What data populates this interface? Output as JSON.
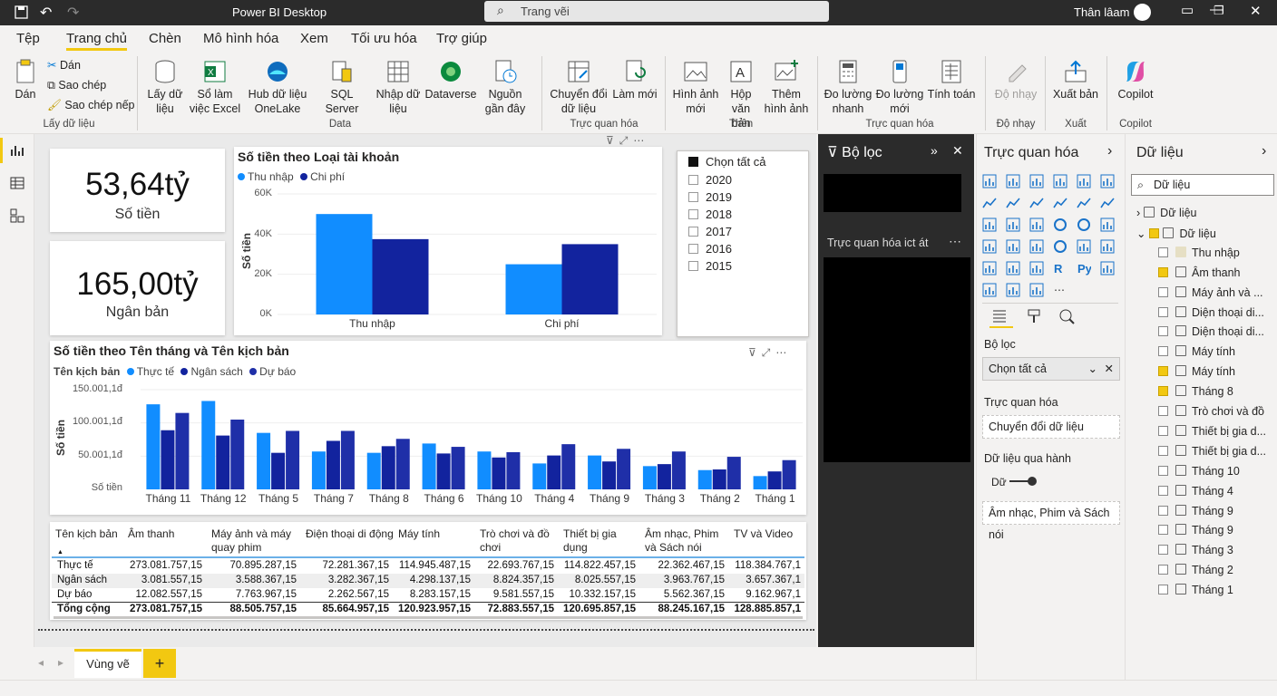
{
  "app": {
    "title": "Power BI Desktop",
    "search_placeholder": "Trang vẽi",
    "user": "Thân lâam"
  },
  "menu": [
    "Tệp",
    "Trang chủ",
    "Chèn",
    "Mô hình hóa",
    "Xem",
    "Tối ưu hóa",
    "Trợ giúp"
  ],
  "ribbon": {
    "paste": "Dán",
    "cut": "Dán",
    "copy": "Sao chép",
    "format_copy": "Sao chép nếp",
    "grp_clipboard": "Lấy dữ liệu",
    "get_data": "Lấy dữ liệu",
    "excel": "Sổ làm việc Excel",
    "onelake": "Hub dữ liệu OneLake",
    "sql": "SQL Server",
    "enter": "Nhập dữ liệu",
    "dataverse": "Dataverse",
    "recent": "Nguồn gần đây",
    "grp_data": "Data",
    "transform": "Chuyển đổi dữ liệu",
    "refresh": "Làm mới",
    "grp_query": "Trực quan hóa",
    "image": "Hình ảnh mới",
    "textbox": "Hộp văn bản",
    "more_visuals": "Thêm hình ảnh",
    "grp_insert": "Thên",
    "measure": "Đo lường nhanh",
    "new_measure": "Đo lường mới",
    "calc": "Tính toán",
    "grp_calc": "Trực quan hóa",
    "sensitivity": "Độ nhạy",
    "grp_sens": "Độ nhạy",
    "publish": "Xuất bản",
    "grp_share": "Xuất",
    "copilot": "Copilot",
    "grp_copilot": "Copilot"
  },
  "kpi": [
    {
      "value": "53,64tỷ",
      "label": "Số tiền"
    },
    {
      "value": "165,00tỷ",
      "label": "Ngân bản"
    }
  ],
  "chart1": {
    "title": "Số tiền theo Loại tài khoản",
    "legend": [
      "Thu nhập",
      "Chi phí"
    ],
    "ticks": [
      "60K",
      "40K",
      "20K",
      "0K"
    ],
    "ylabel": "Số tiền"
  },
  "chart2": {
    "title": "Số tiền theo Tên tháng và Tên kịch bản",
    "legend_title": "Tên kịch bản",
    "legend": [
      "Thực tế",
      "Ngân sách",
      "Dự báo"
    ],
    "ticks": [
      "150.001,1đ",
      "100.001,1đ",
      "50.001,1đ",
      "Số tiền"
    ],
    "ylabel": "Số tiền"
  },
  "chart_data": [
    {
      "type": "bar",
      "title": "Số tiền theo Loại tài khoản",
      "ylabel": "Số tiền",
      "categories": [
        "Thu nhập",
        "Chi phí"
      ],
      "series": [
        {
          "name": "Thu nhập",
          "values": [
            50000,
            25000
          ]
        },
        {
          "name": "Chi phí",
          "values": [
            37500,
            35000
          ]
        }
      ],
      "ylim": [
        0,
        60000
      ]
    },
    {
      "type": "bar",
      "title": "Số tiền theo Tên tháng và Tên kịch bản",
      "ylabel": "Số tiền",
      "categories": [
        "Tháng 11",
        "Tháng 12",
        "Tháng 5",
        "Tháng 7",
        "Tháng 8",
        "Tháng 6",
        "Tháng 10",
        "Tháng 4",
        "Tháng 9",
        "Tháng 3",
        "Tháng 2",
        "Tháng 1"
      ],
      "series": [
        {
          "name": "Thực tế",
          "values": [
            128000,
            133000,
            85000,
            57000,
            55000,
            69000,
            57000,
            39000,
            51000,
            35000,
            29000,
            20000
          ]
        },
        {
          "name": "Ngân sách",
          "values": [
            89000,
            81000,
            55000,
            73000,
            65000,
            54000,
            48000,
            51000,
            42000,
            38000,
            30000,
            27000
          ]
        },
        {
          "name": "Dự báo",
          "values": [
            115000,
            105000,
            88000,
            88000,
            76000,
            64000,
            56000,
            68000,
            61000,
            57000,
            49000,
            44000
          ]
        }
      ],
      "ylim": [
        0,
        150000
      ]
    }
  ],
  "slicer": {
    "all": "Chọn tất cả",
    "years": [
      "2020",
      "2019",
      "2018",
      "2017",
      "2016",
      "2015"
    ]
  },
  "table": {
    "headers": [
      "Tên kịch bản",
      "Âm thanh",
      "Máy ảnh và máy quay phim",
      "Điện thoại di động",
      "Máy tính",
      "Trò chơi và đồ chơi",
      "Thiết bị gia dụng",
      "Âm nhạc, Phim và Sách nói",
      "TV và Video"
    ],
    "rows": [
      [
        "Thực tế",
        "273.081.757,15",
        "70.895.287,15",
        "72.281.367,15",
        "114.945.487,15",
        "22.693.767,15",
        "114.822.457,15",
        "22.362.467,15",
        "118.384.767,1"
      ],
      [
        "Ngân sách",
        "3.081.557,15",
        "3.588.367,15",
        "3.282.367,15",
        "4.298.137,15",
        "8.824.357,15",
        "8.025.557,15",
        "3.963.767,15",
        "3.657.367,1"
      ],
      [
        "Dự báo",
        "12.082.557,15",
        "7.763.967,15",
        "2.262.567,15",
        "8.283.157,15",
        "9.581.557,15",
        "10.332.157,15",
        "5.562.367,15",
        "9.162.967,1"
      ]
    ],
    "total": [
      "Tổng cộng",
      "273.081.757,15",
      "88.505.757,15",
      "85.664.957,15",
      "120.923.957,15",
      "72.883.557,15",
      "120.695.857,15",
      "88.245.167,15",
      "128.885.857,1"
    ]
  },
  "filter_pane": {
    "title": "Bộ lọc",
    "section": "Trực quan hóa ict át"
  },
  "viz_pane": {
    "title": "Trực quan hóa",
    "filters_label": "Bộ lọc",
    "filter_value": "Chọn tất cả",
    "viz_label": "Trực quan hóa",
    "viz_value": "Chuyển đổi dữ liệu",
    "drill_label": "Dữ liệu qua hành",
    "drill_toggle": "Dữ",
    "drill_value": "Âm nhạc, Phim và Sách nói"
  },
  "data_pane": {
    "title": "Dữ liệu",
    "search": "Dữ liệu",
    "items": [
      {
        "label": "Dữ liệu",
        "checked": false,
        "level": 0
      },
      {
        "label": "Dữ liệu",
        "checked": true,
        "level": 0
      },
      {
        "label": "Thu nhập",
        "checked": false,
        "level": 1
      },
      {
        "label": "Âm thanh",
        "checked": true,
        "level": 1
      },
      {
        "label": "Máy ảnh và ...",
        "checked": false,
        "level": 1
      },
      {
        "label": "Diện thoại di...",
        "checked": false,
        "level": 1
      },
      {
        "label": "Diện thoại di...",
        "checked": false,
        "level": 1
      },
      {
        "label": "Máy tính",
        "checked": false,
        "level": 1
      },
      {
        "label": "Máy tính",
        "checked": true,
        "level": 1
      },
      {
        "label": "Tháng 8",
        "checked": true,
        "level": 1
      },
      {
        "label": "Trò chơi và đồ",
        "checked": false,
        "level": 1
      },
      {
        "label": "Thiết bị gia d...",
        "checked": false,
        "level": 1
      },
      {
        "label": "Thiết bị gia d...",
        "checked": false,
        "level": 1
      },
      {
        "label": "Tháng 10",
        "checked": false,
        "level": 1
      },
      {
        "label": "Tháng 4",
        "checked": false,
        "level": 1
      },
      {
        "label": "Tháng 9",
        "checked": false,
        "level": 1
      },
      {
        "label": "Tháng 9",
        "checked": false,
        "level": 1
      },
      {
        "label": "Tháng 3",
        "checked": false,
        "level": 1
      },
      {
        "label": "Tháng 2",
        "checked": false,
        "level": 1
      },
      {
        "label": "Tháng 1",
        "checked": false,
        "level": 1
      }
    ]
  },
  "pages": {
    "tab": "Vùng vẽ",
    "add": "+"
  },
  "colors": {
    "series1": "#118dff",
    "series2": "#12239e",
    "series3": "#1f2fa8",
    "accent": "#f2c811"
  }
}
